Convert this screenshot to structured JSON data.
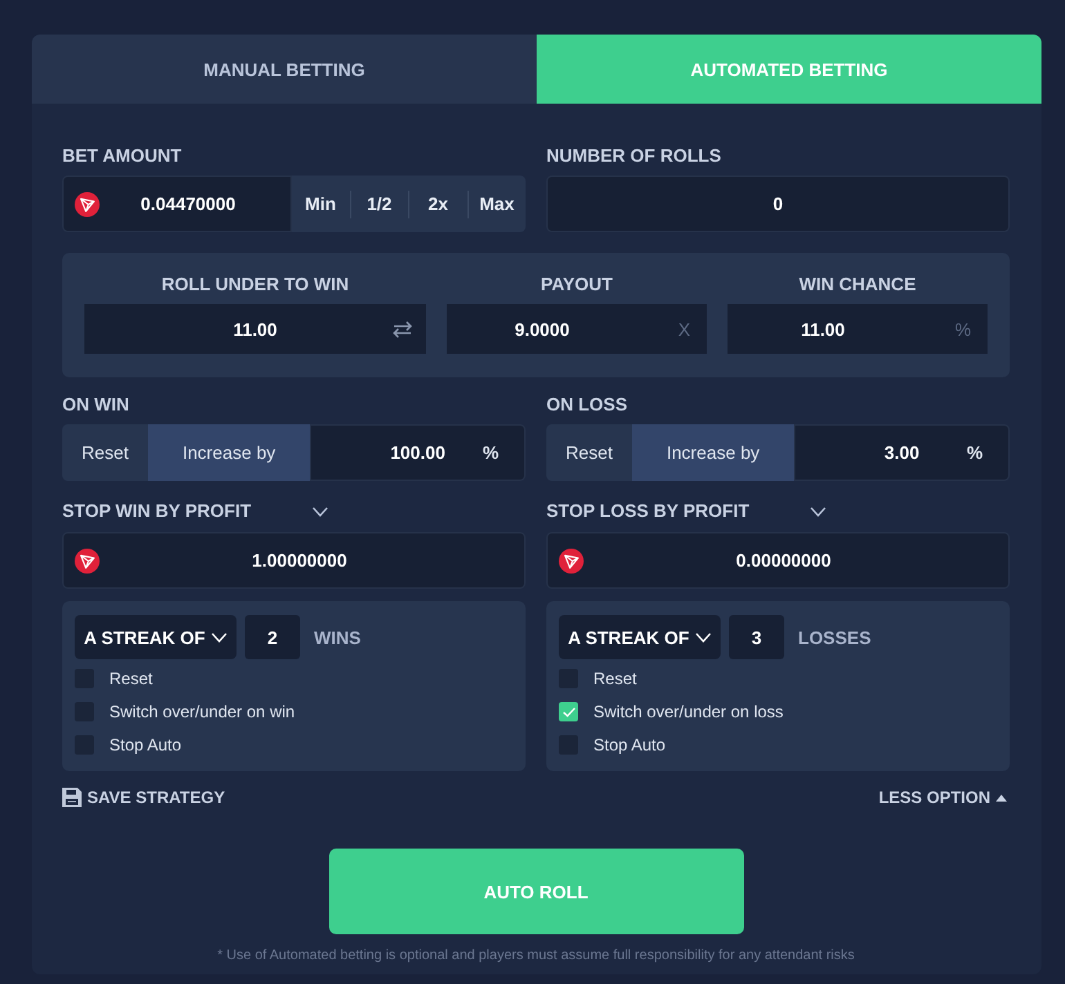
{
  "tabs": [
    {
      "label": "MANUAL BETTING",
      "selected": false
    },
    {
      "label": "AUTOMATED BETTING",
      "selected": true
    }
  ],
  "bet_amount": {
    "label": "BET AMOUNT",
    "value": "0.04470000",
    "quick_buttons": [
      "Min",
      "1/2",
      "2x",
      "Max"
    ]
  },
  "number_of_rolls": {
    "label": "NUMBER OF ROLLS",
    "value": "0"
  },
  "roll_settings": [
    {
      "label": "ROLL UNDER TO WIN",
      "value": "11.00",
      "kind": "swap"
    },
    {
      "label": "PAYOUT",
      "value": "9.0000",
      "kind": "unit",
      "unit": "X"
    },
    {
      "label": "WIN CHANCE",
      "value": "11.00",
      "kind": "unit",
      "unit": "%"
    }
  ],
  "on_result": [
    {
      "label": "ON WIN",
      "modes": [
        {
          "label": "Reset",
          "selected": false
        },
        {
          "label": "Increase by",
          "selected": true
        }
      ],
      "value": "100.00",
      "unit": "%"
    },
    {
      "label": "ON LOSS",
      "modes": [
        {
          "label": "Reset",
          "selected": false
        },
        {
          "label": "Increase by",
          "selected": true
        }
      ],
      "value": "3.00",
      "unit": "%"
    }
  ],
  "stop_by_profit": [
    {
      "label": "STOP WIN BY PROFIT",
      "value": "1.00000000"
    },
    {
      "label": "STOP LOSS BY PROFIT",
      "value": "0.00000000"
    }
  ],
  "streaks": [
    {
      "select": "A STREAK OF",
      "count": "2",
      "unit": "WINS",
      "options": [
        {
          "label": "Reset",
          "checked": false
        },
        {
          "label": "Switch over/under on win",
          "checked": false
        },
        {
          "label": "Stop Auto",
          "checked": false
        }
      ]
    },
    {
      "select": "A STREAK OF",
      "count": "3",
      "unit": "LOSSES",
      "options": [
        {
          "label": "Reset",
          "checked": false
        },
        {
          "label": "Switch over/under on loss",
          "checked": true
        },
        {
          "label": "Stop Auto",
          "checked": false
        }
      ]
    }
  ],
  "save_strategy": "SAVE STRATEGY",
  "less_option": "LESS OPTION",
  "auto_roll": "AUTO ROLL",
  "disclaimer": "* Use of Automated betting is optional and players must assume full responsibility for any attendant risks"
}
